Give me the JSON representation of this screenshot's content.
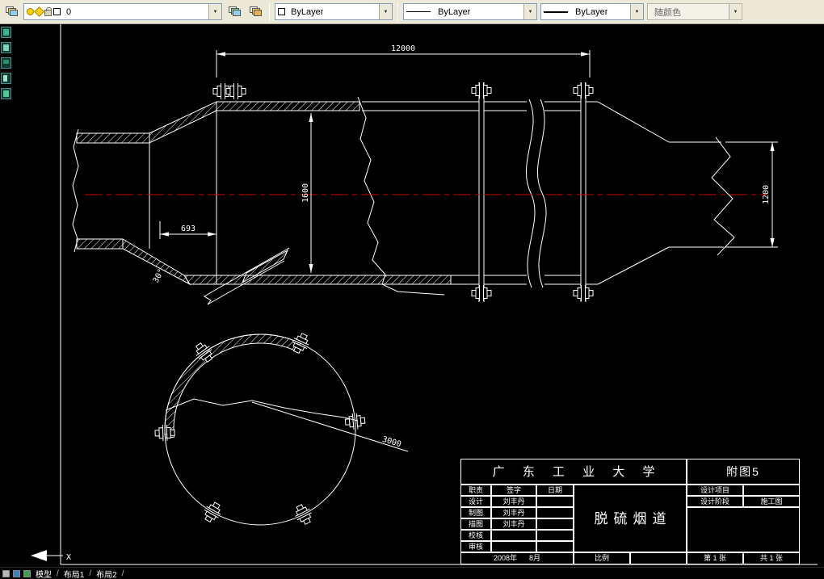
{
  "toolbar": {
    "layer_combo": {
      "value": "0"
    },
    "color_combo": {
      "value": "ByLayer"
    },
    "linetype_combo": {
      "value": "ByLayer"
    },
    "lineweight_combo": {
      "value": "ByLayer"
    },
    "plotstyle_combo": {
      "value": "随颜色"
    }
  },
  "drawing": {
    "colors": {
      "line": "#ffffff",
      "centerline": "#cc0000",
      "background": "#000000"
    },
    "dims": {
      "total_length": "12000",
      "inlet_length": "693",
      "duct_diameter": "1600",
      "outlet_diameter": "1200",
      "branch_angle": "30°",
      "section_radius": "3000"
    }
  },
  "title_block": {
    "university": "广 东 工 业 大 学",
    "figure_label": "附图5",
    "drawing_title": "脱硫烟道",
    "col_role": "职责",
    "col_sign": "签字",
    "col_date": "日期",
    "rows": [
      {
        "role": "设计",
        "name": "刘丰丹"
      },
      {
        "role": "制图",
        "name": "刘丰丹"
      },
      {
        "role": "描图",
        "name": "刘丰丹"
      },
      {
        "role": "校核",
        "name": ""
      },
      {
        "role": "审核",
        "name": ""
      }
    ],
    "date_value": "2008年      8月",
    "scale_label": "比例",
    "project_label": "设计项目",
    "stage_label": "设计阶段",
    "stage_value": "施工图",
    "sheet_no": "第 1 张",
    "sheet_total": "共 1 张"
  },
  "status_bar": {
    "tabs": [
      "模型",
      "布局1",
      "布局2"
    ],
    "separator": "/"
  },
  "ucs": {
    "x_axis": "X"
  }
}
